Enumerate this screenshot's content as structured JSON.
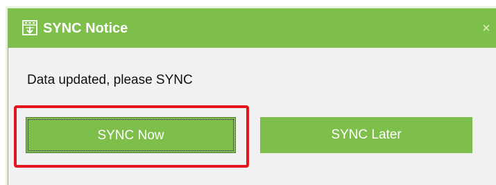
{
  "dialog": {
    "title": "SYNC Notice",
    "close_glyph": "×",
    "message": "Data updated, please SYNC",
    "buttons": {
      "sync_now": "SYNC Now",
      "sync_later": "SYNC Later"
    }
  },
  "icons": {
    "app": "sync-app-icon",
    "close": "close-icon"
  },
  "colors": {
    "accent": "#7dbf4a",
    "highlight": "#e3141c",
    "background": "#f1f1f1"
  }
}
